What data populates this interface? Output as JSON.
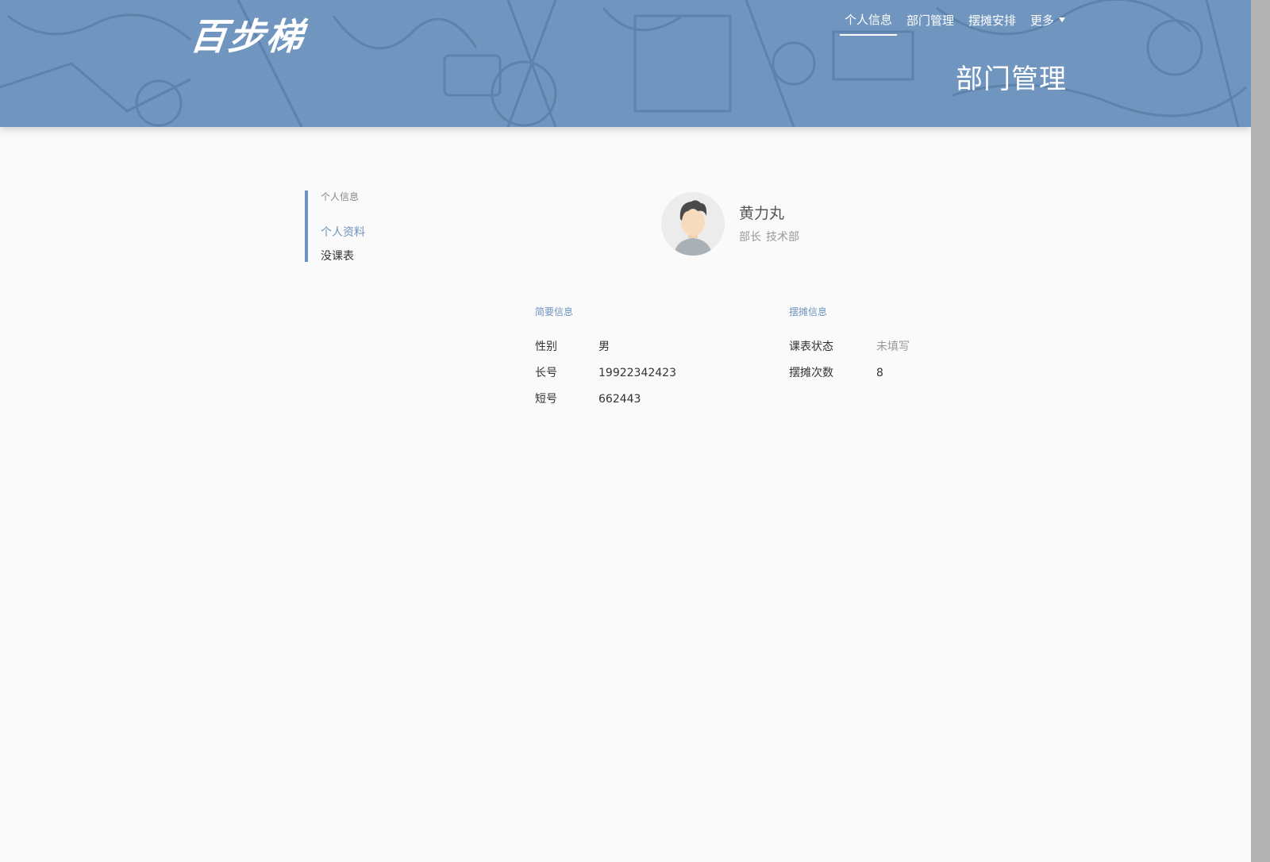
{
  "header": {
    "logo": "百步梯",
    "page_title": "部门管理",
    "nav": [
      {
        "label": "个人信息"
      },
      {
        "label": "部门管理"
      },
      {
        "label": "摆摊安排"
      },
      {
        "label": "更多"
      }
    ]
  },
  "sidebar": {
    "title": "个人信息",
    "items": [
      {
        "label": "个人资料"
      },
      {
        "label": "没课表"
      }
    ]
  },
  "profile": {
    "name": "黄力丸",
    "position": "部长",
    "department": "技术部"
  },
  "brief_info": {
    "title": "简要信息",
    "rows": [
      {
        "label": "性别",
        "value": "男"
      },
      {
        "label": "长号",
        "value": "19922342423"
      },
      {
        "label": "短号",
        "value": "662443"
      }
    ]
  },
  "stall_info": {
    "title": "摆摊信息",
    "rows": [
      {
        "label": "课表状态",
        "value": "未填写"
      },
      {
        "label": "摆摊次数",
        "value": "8"
      }
    ]
  },
  "colors": {
    "header_bg": "#7096c0",
    "accent": "#6f93bf",
    "page_bg": "#fafafa"
  }
}
